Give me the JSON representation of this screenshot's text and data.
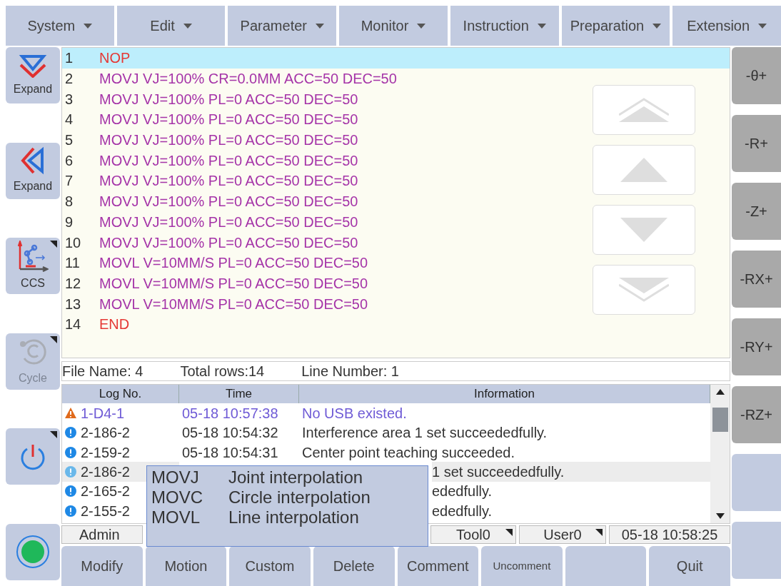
{
  "menu": [
    {
      "label": "System"
    },
    {
      "label": "Edit"
    },
    {
      "label": "Parameter"
    },
    {
      "label": "Monitor"
    },
    {
      "label": "Instruction"
    },
    {
      "label": "Preparation"
    },
    {
      "label": "Extension"
    }
  ],
  "left_buttons": [
    {
      "kind": "expand-down",
      "label": "Expand",
      "disabled": false,
      "corner": false
    },
    {
      "kind": "expand-left",
      "label": "Expand",
      "disabled": false,
      "corner": false
    },
    {
      "kind": "robot",
      "label": "CCS",
      "disabled": false,
      "corner": true
    },
    {
      "kind": "cycle",
      "label": "Cycle",
      "disabled": true,
      "corner": true
    },
    {
      "kind": "power",
      "disabled": false,
      "corner": true
    },
    {
      "kind": "record",
      "disabled": false,
      "corner": false
    }
  ],
  "program": [
    {
      "line": "1",
      "code": "NOP",
      "kind": "control",
      "selected": true
    },
    {
      "line": "2",
      "code": "MOVJ VJ=100% CR=0.0MM ACC=50 DEC=50",
      "kind": "motion",
      "selected": false
    },
    {
      "line": "3",
      "code": "MOVJ VJ=100% PL=0 ACC=50 DEC=50",
      "kind": "motion",
      "selected": false
    },
    {
      "line": "4",
      "code": "MOVJ VJ=100% PL=0 ACC=50 DEC=50",
      "kind": "motion",
      "selected": false
    },
    {
      "line": "5",
      "code": "MOVJ VJ=100% PL=0 ACC=50 DEC=50",
      "kind": "motion",
      "selected": false
    },
    {
      "line": "6",
      "code": "MOVJ VJ=100% PL=0 ACC=50 DEC=50",
      "kind": "motion",
      "selected": false
    },
    {
      "line": "7",
      "code": "MOVJ VJ=100% PL=0 ACC=50 DEC=50",
      "kind": "motion",
      "selected": false
    },
    {
      "line": "8",
      "code": "MOVJ VJ=100% PL=0 ACC=50 DEC=50",
      "kind": "motion",
      "selected": false
    },
    {
      "line": "9",
      "code": "MOVJ VJ=100% PL=0 ACC=50 DEC=50",
      "kind": "motion",
      "selected": false
    },
    {
      "line": "10",
      "code": "MOVJ VJ=100% PL=0 ACC=50 DEC=50",
      "kind": "motion",
      "selected": false
    },
    {
      "line": "11",
      "code": "MOVL V=10MM/S PL=0 ACC=50 DEC=50",
      "kind": "motion",
      "selected": false
    },
    {
      "line": "12",
      "code": "MOVL V=10MM/S PL=0 ACC=50 DEC=50",
      "kind": "motion",
      "selected": false
    },
    {
      "line": "13",
      "code": "MOVL V=10MM/S PL=0 ACC=50 DEC=50",
      "kind": "motion",
      "selected": false
    },
    {
      "line": "14",
      "code": "END",
      "kind": "control",
      "selected": false
    }
  ],
  "scroll_buttons": [
    {
      "kind": "page-up"
    },
    {
      "kind": "up"
    },
    {
      "kind": "down"
    },
    {
      "kind": "page-down"
    }
  ],
  "info_bar": [
    "File Name: 4",
    "Total rows:14",
    "Line Number: 1"
  ],
  "log": {
    "columns": [
      "Log No.",
      "Time",
      "Information"
    ],
    "rows": [
      {
        "kind": "warning",
        "covered": false,
        "selected": false,
        "number": "1-D4-1",
        "time": "05-18 10:57:38",
        "information": "No USB existed."
      },
      {
        "kind": "info",
        "covered": false,
        "selected": false,
        "number": "2-186-2",
        "time": "05-18 10:54:32",
        "information": "Interference area 1 set succeededfully."
      },
      {
        "kind": "info",
        "covered": false,
        "selected": false,
        "number": "2-159-2",
        "time": "05-18 10:54:31",
        "information": "Center point teaching succeeded."
      },
      {
        "kind": "info",
        "covered": true,
        "selected": true,
        "number": "2-186-2",
        "information": "1 set succeededfully."
      },
      {
        "kind": "info",
        "covered": true,
        "selected": false,
        "number": "2-165-2",
        "information": "ededfully."
      },
      {
        "kind": "info",
        "covered": true,
        "selected": false,
        "number": "2-155-2",
        "information": "ededfully."
      }
    ]
  },
  "status_bar": {
    "user": "Admin",
    "tool": "Tool0",
    "user_frame": "User0",
    "datetime": "05-18 10:58:25"
  },
  "popup": [
    {
      "code": "MOVJ",
      "description": "Joint interpolation"
    },
    {
      "code": "MOVC",
      "description": "Circle interpolation"
    },
    {
      "code": "MOVL",
      "description": "Line interpolation"
    }
  ],
  "bottom_buttons": [
    {
      "label": "Modify",
      "kind": "normal"
    },
    {
      "label": "Motion",
      "kind": "normal"
    },
    {
      "label": "Custom",
      "kind": "normal"
    },
    {
      "label": "Delete",
      "kind": "normal"
    },
    {
      "label": "Comment",
      "kind": "normal"
    },
    {
      "label": "Uncomment",
      "kind": "small"
    },
    {
      "kind": "empty"
    },
    {
      "label": "Quit",
      "kind": "normal"
    }
  ],
  "right_buttons": [
    {
      "label": "-θ+",
      "kind": "jog"
    },
    {
      "label": "-R+",
      "kind": "jog"
    },
    {
      "label": "-Z+",
      "kind": "jog"
    },
    {
      "label": "-RX+",
      "kind": "jog"
    },
    {
      "label": "-RY+",
      "kind": "jog"
    },
    {
      "label": "-RZ+",
      "kind": "jog"
    },
    {
      "kind": "empty"
    },
    {
      "kind": "empty"
    }
  ]
}
